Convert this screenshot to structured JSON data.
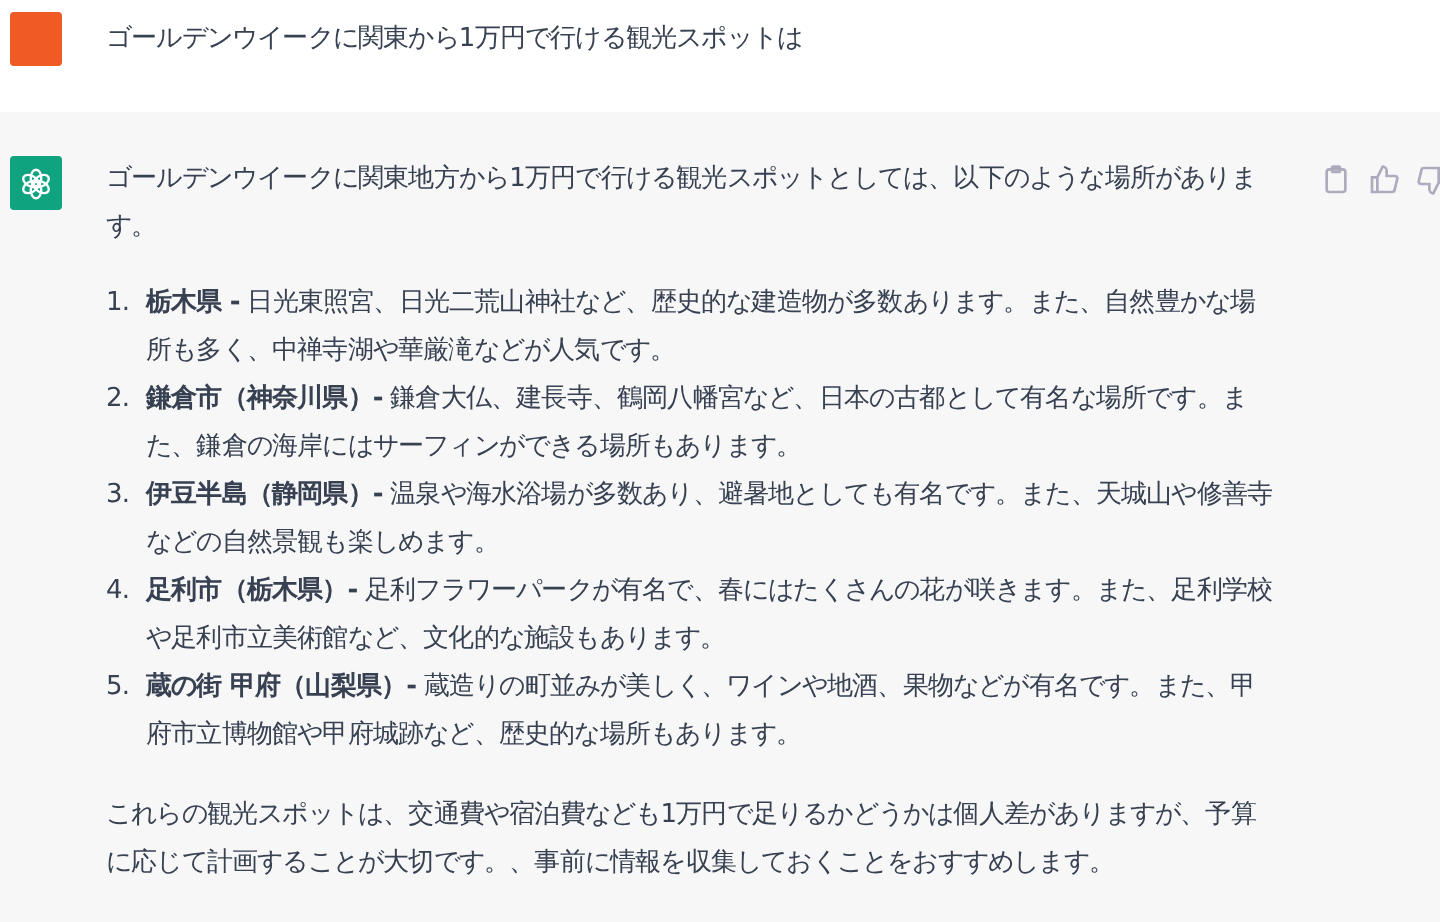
{
  "user_message": {
    "text": "ゴールデンウイークに関東から1万円で行ける観光スポットは"
  },
  "assistant_message": {
    "intro": "ゴールデンウイークに関東地方から1万円で行ける観光スポットとしては、以下のような場所があります。",
    "items": [
      {
        "number": "1.",
        "text": "**栃木県 -** 日光東照宮、日光二荒山神社など、歴史的な建造物が多数あります。また、自然豊かな場所も多く、中禅寺湖や華厳滝などが人気です。"
      },
      {
        "number": "2.",
        "text": "**鎌倉市（神奈川県）-** 鎌倉大仏、建長寺、鶴岡八幡宮など、日本の古都として有名な場所です。また、鎌倉の海岸にはサーフィンができる場所もあります。"
      },
      {
        "number": "3.",
        "text": "**伊豆半島（静岡県）-** 温泉や海水浴場が多数あり、避暑地としても有名です。また、天城山や修善寺などの自然景観も楽しめます。"
      },
      {
        "number": "4.",
        "text": "**足利市（栃木県）-** 足利フラワーパークが有名で、春にはたくさんの花が咲きます。また、足利学校や足利市立美術館など、文化的な施設もあります。"
      },
      {
        "number": "5.",
        "text": "**蔵の街 甲府（山梨県）-** 蔵造りの町並みが美しく、ワインや地酒、果物などが有名です。また、甲府市立博物館や甲府城跡など、歴史的な場所もあります。"
      }
    ],
    "closing": "これらの観光スポットは、交通費や宿泊費なども1万円で足りるかどうかは個人差がありますが、予算に応じて計画することが大切です。、事前に情報を収集しておくことをおすすめします。"
  }
}
